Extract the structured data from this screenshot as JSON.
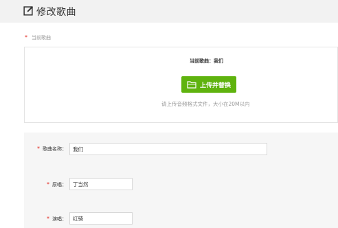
{
  "header": {
    "title": "修改歌曲",
    "icon": "edit-icon"
  },
  "upload": {
    "section_label": "当前歌曲",
    "current_song": "当前歌曲：我们",
    "button_label": "上传并替换",
    "button_icon": "folder-icon",
    "hint": "请上传音频格式文件，大小在20M以内"
  },
  "form": {
    "song_name": {
      "label": "歌曲名称：",
      "value": "我们"
    },
    "original_singer": {
      "label": "原唱：",
      "value": "丁当然"
    },
    "performer": {
      "label": "演唱：",
      "value": "红骑"
    }
  },
  "colors": {
    "accent": "#5fb30e",
    "required": "#e2231a"
  }
}
